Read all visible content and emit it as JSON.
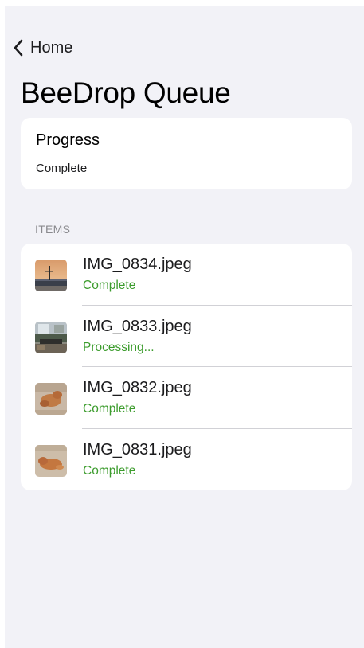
{
  "nav": {
    "back_label": "Home",
    "back_icon": "chevron-left-icon"
  },
  "title": "BeeDrop Queue",
  "progress": {
    "title": "Progress",
    "status": "Complete"
  },
  "section_header": "ITEMS",
  "items": [
    {
      "name": "IMG_0834.jpeg",
      "status": "Complete",
      "thumbnail": "sunset-landscape-photo"
    },
    {
      "name": "IMG_0833.jpeg",
      "status": "Processing...",
      "thumbnail": "room-scene-photo"
    },
    {
      "name": "IMG_0832.jpeg",
      "status": "Complete",
      "thumbnail": "dog-on-floor-photo"
    },
    {
      "name": "IMG_0831.jpeg",
      "status": "Complete",
      "thumbnail": "dog-on-floor-photo"
    }
  ],
  "colors": {
    "background": "#f2f2f7",
    "card": "#ffffff",
    "status_green": "#3c9c2d",
    "section_header": "#8a8a8e"
  }
}
